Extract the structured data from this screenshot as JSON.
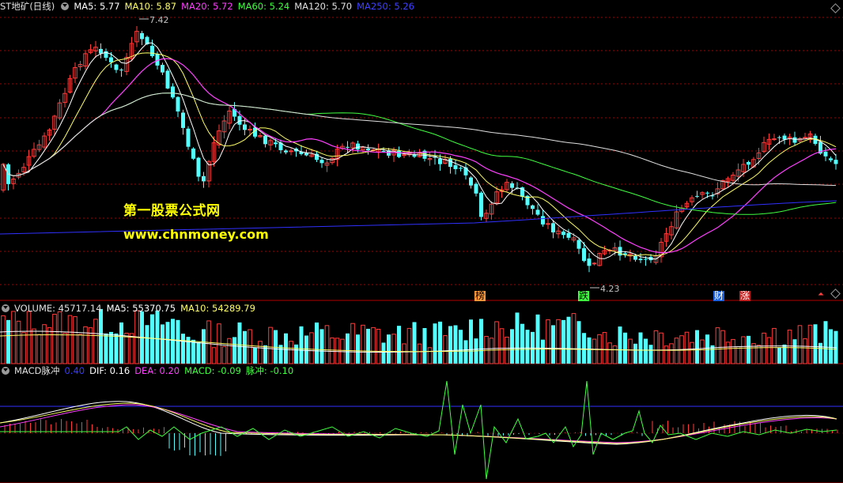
{
  "main_header": {
    "title": "ST地矿(日线)",
    "ma5": "MA5: 5.77",
    "ma10": "MA10: 5.87",
    "ma20": "MA20: 5.72",
    "ma60": "MA60: 5.24",
    "ma120": "MA120: 5.70",
    "ma250": "MA250: 5.26"
  },
  "annotations": {
    "high": "7.42",
    "low": "4.23"
  },
  "tags": [
    "榜",
    "跌",
    "财",
    "涨"
  ],
  "watermark": {
    "line1": "第一股票公式网",
    "line2": "www.chnmoney.com"
  },
  "volume_header": {
    "volume": "VOLUME: 45717.14",
    "ma5": "MA5: 55370.75",
    "ma10": "MA10: 54289.79"
  },
  "macd_header": {
    "name": "MACD脉冲",
    "param": "0.40",
    "dif": "DIF: 0.16",
    "dea": "DEA: 0.20",
    "macd": "MACD: -0.09",
    "pulse": "脉冲: -0.10"
  },
  "colors": {
    "up": "#ff3c3c",
    "down": "#54ffff",
    "ma5": "#ffffff",
    "ma10": "#ffff66",
    "ma20": "#ff40ff",
    "ma60": "#40ff40",
    "ma120": "#e0e0e0",
    "ma250": "#3030ff",
    "pulse": "#40ff40",
    "grid": "#a00000"
  },
  "chart_data": {
    "type": "candlestick",
    "title": "ST地矿(日线)",
    "price_max": 7.42,
    "price_min": 4.23,
    "ma_latest": {
      "MA5": 5.77,
      "MA10": 5.87,
      "MA20": 5.72,
      "MA60": 5.24,
      "MA120": 5.7,
      "MA250": 5.26
    },
    "volume_latest": 45717.14,
    "volume_ma_latest": {
      "MA5": 55370.75,
      "MA10": 54289.79
    },
    "macd_latest": {
      "DIF": 0.16,
      "DEA": 0.2,
      "MACD": -0.09,
      "pulse": -0.1
    }
  }
}
